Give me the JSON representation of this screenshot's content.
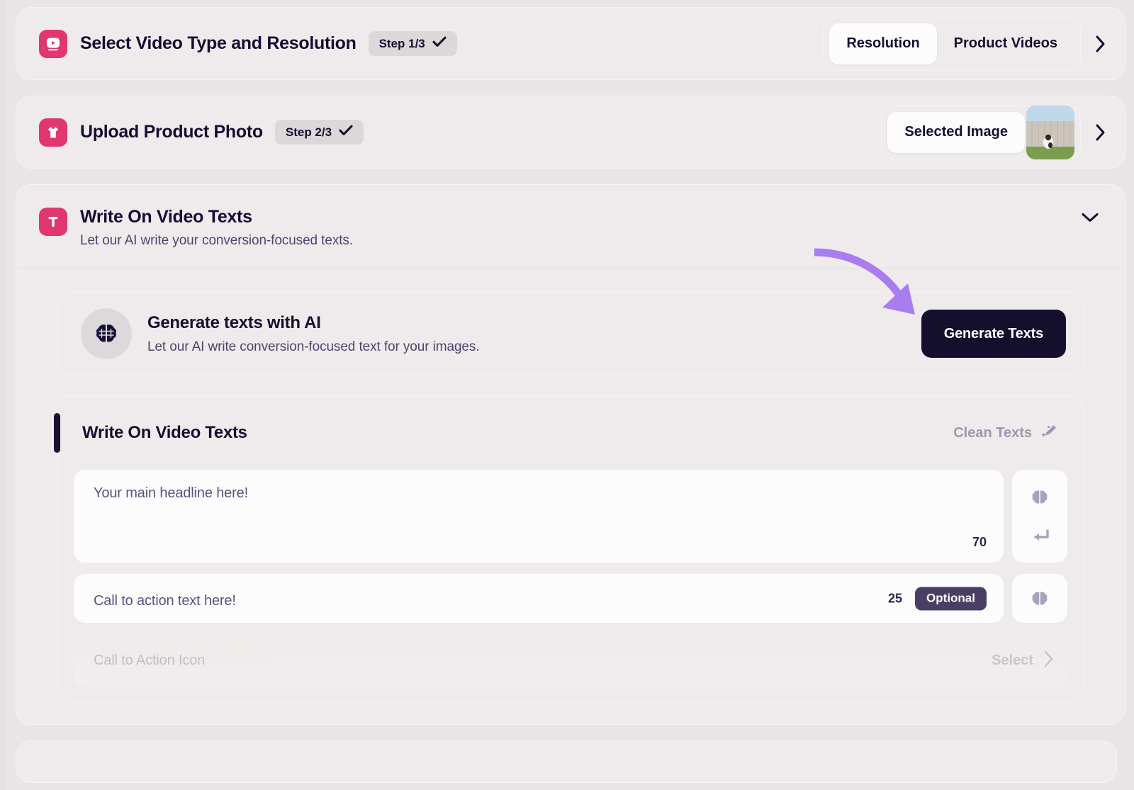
{
  "theme": {
    "page_bg": "#e9e5e6",
    "card_bg": "#efebec",
    "accent_pink": "#e0376e",
    "dark": "#150f2e",
    "muted_purple": "#4d4470",
    "annotation_purple": "#a97cf0",
    "optional_badge": "#4b3e66"
  },
  "steps": [
    {
      "icon": "video-play-icon",
      "title": "Select Video Type and Resolution",
      "badge": "Step 1/3",
      "badge_check": "check-icon",
      "options": [
        {
          "label": "Resolution",
          "active": true
        },
        {
          "label": "Product Videos",
          "active": false
        }
      ],
      "chevron": "chevron-right-icon"
    },
    {
      "icon": "tshirt-icon",
      "title": "Upload Product Photo",
      "badge": "Step 2/3",
      "badge_check": "check-icon",
      "selected_image_label": "Selected Image",
      "thumbnail_alt": "dog-in-front-of-fence-thumbnail",
      "chevron": "chevron-right-icon"
    }
  ],
  "section": {
    "icon": "text-t-icon",
    "title": "Write On Video Texts",
    "subtitle": "Let our AI write your conversion-focused texts.",
    "chevron": "chevron-down-icon",
    "ai_card": {
      "icon": "brain-icon",
      "title": "Generate texts with AI",
      "subtitle": "Let our AI write conversion-focused text for your images.",
      "button_label": "Generate Texts"
    },
    "texts_panel": {
      "title": "Write On Video Texts",
      "clean_label": "Clean Texts",
      "clean_icon": "broom-sparkle-icon",
      "fields": [
        {
          "name": "headline",
          "placeholder": "Your main headline here!",
          "value": "",
          "counter": "70",
          "optional": false,
          "actions": [
            "brain-icon",
            "enter-return-icon"
          ]
        },
        {
          "name": "call-to-action",
          "placeholder": "Call to action text here!",
          "value": "",
          "counter": "25",
          "optional": true,
          "optional_label": "Optional",
          "actions": [
            "brain-icon"
          ]
        }
      ],
      "cta_icon_row": {
        "label": "Call to Action Icon",
        "select_label": "Select",
        "chevron": "chevron-right-icon",
        "disabled": true
      }
    }
  },
  "annotation": {
    "type": "curved-arrow",
    "color": "#a97cf0",
    "points_to": "Generate Texts"
  }
}
